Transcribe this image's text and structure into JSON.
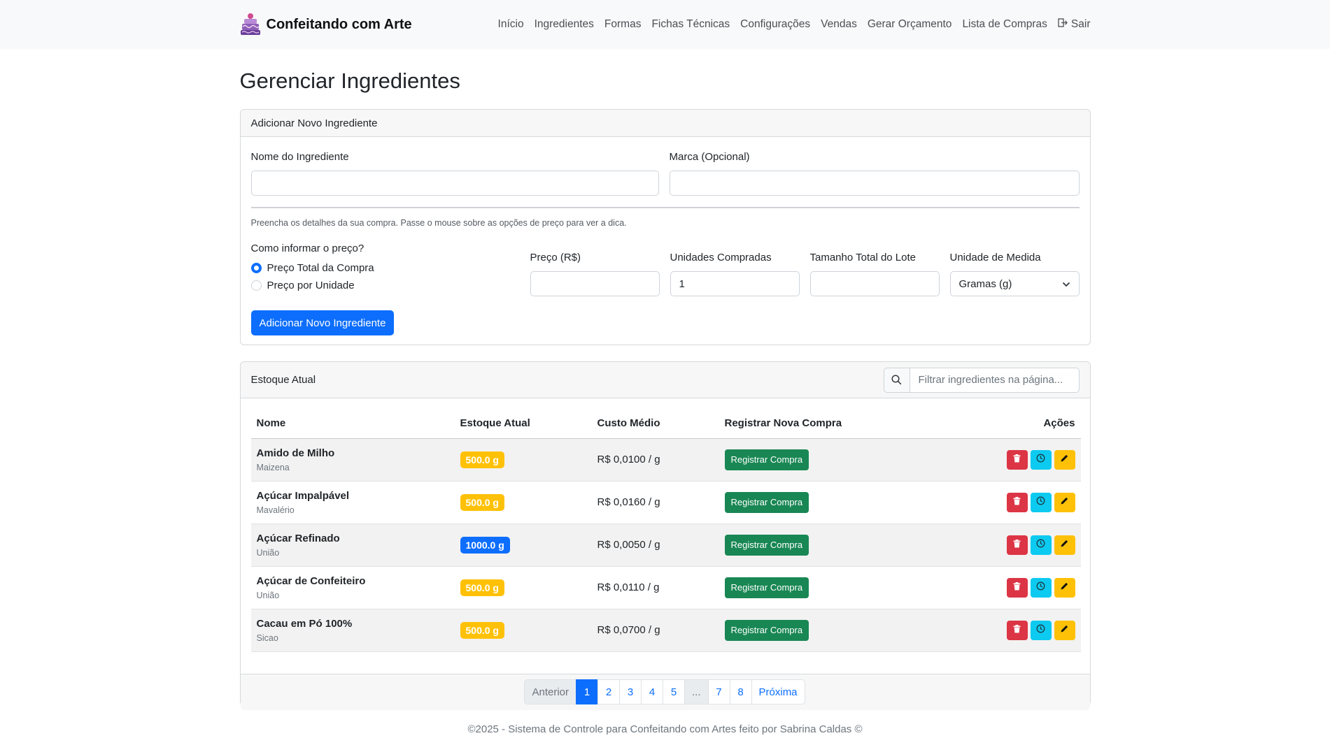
{
  "colors": {
    "primary": "#0d6efd",
    "success": "#198754",
    "danger": "#dc3545",
    "info": "#0dcaf0",
    "warning": "#ffc107",
    "navbar_bg": "#f8f9fa"
  },
  "navbar": {
    "brand": "Confeitando com Arte",
    "logo_icon": "cake-logo-icon",
    "links": [
      "Início",
      "Ingredientes",
      "Formas",
      "Fichas Técnicas",
      "Configurações",
      "Vendas",
      "Gerar Orçamento",
      "Lista de Compras"
    ],
    "logout": "Sair",
    "logout_icon": "logout-icon"
  },
  "page": {
    "title": "Gerenciar Ingredientes"
  },
  "form": {
    "header": "Adicionar Novo Ingrediente",
    "name_label": "Nome do Ingrediente",
    "name_value": "",
    "brand_label": "Marca (Opcional)",
    "brand_value": "",
    "hint": "Preencha os detalhes da sua compra. Passe o mouse sobre as opções de preço para ver a dica.",
    "price_question": "Como informar o preço?",
    "price_options": [
      "Preço Total da Compra",
      "Preço por Unidade"
    ],
    "price_selected": 0,
    "price_label": "Preço (R$)",
    "price_value": "",
    "units_label": "Unidades Compradas",
    "units_value": "1",
    "lot_label": "Tamanho Total do Lote",
    "lot_value": "",
    "unit_label": "Unidade de Medida",
    "unit_value": "Gramas (g)",
    "submit": "Adicionar Novo Ingrediente"
  },
  "stock": {
    "header": "Estoque Atual",
    "search_icon": "search-icon",
    "search_placeholder": "Filtrar ingredientes na página...",
    "columns": [
      "Nome",
      "Estoque Atual",
      "Custo Médio",
      "Registrar Nova Compra",
      "Ações"
    ],
    "register_label": "Registrar Compra",
    "rows": [
      {
        "name": "Amido de Milho",
        "brand": "Maizena",
        "stock": "500.0 g",
        "stock_color": "#ffc107",
        "cost": "R$ 0,0100 / g"
      },
      {
        "name": "Açúcar Impalpável",
        "brand": "Mavalério",
        "stock": "500.0 g",
        "stock_color": "#ffc107",
        "cost": "R$ 0,0160 / g"
      },
      {
        "name": "Açúcar Refinado",
        "brand": "União",
        "stock": "1000.0 g",
        "stock_color": "#0d6efd",
        "cost": "R$ 0,0050 / g"
      },
      {
        "name": "Açúcar de Confeiteiro",
        "brand": "União",
        "stock": "500.0 g",
        "stock_color": "#ffc107",
        "cost": "R$ 0,0110 / g"
      },
      {
        "name": "Cacau em Pó 100%",
        "brand": "Sicao",
        "stock": "500.0 g",
        "stock_color": "#ffc107",
        "cost": "R$ 0,0700 / g"
      }
    ],
    "action_icons": [
      "trash-icon",
      "clock-icon",
      "pencil-icon"
    ]
  },
  "pagination": {
    "prev": "Anterior",
    "pages": [
      "1",
      "2",
      "3",
      "4",
      "5",
      "...",
      "7",
      "8"
    ],
    "active": "1",
    "next": "Próxima"
  },
  "footer": {
    "text": "©2025 - Sistema de Controle para Confeitando com Artes feito por Sabrina Caldas ©"
  }
}
